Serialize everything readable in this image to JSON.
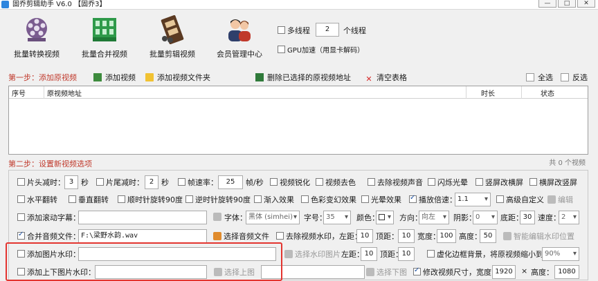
{
  "window": {
    "title": "固乔剪辑助手 V6.0 【固乔3】",
    "minimize": "—",
    "maximize": "□",
    "close": "✕"
  },
  "toolbar": {
    "tools": [
      {
        "label": "批量转换视频",
        "icon": "film-reel-icon"
      },
      {
        "label": "批量合并视频",
        "icon": "building-merge-icon"
      },
      {
        "label": "批量剪辑视频",
        "icon": "film-cut-icon"
      },
      {
        "label": "会员管理中心",
        "icon": "users-icon"
      }
    ],
    "multithread_label": "多线程",
    "thread_count": "2",
    "thread_unit": "个线程",
    "gpu_label": "GPU加速（用显卡解码）"
  },
  "step1": {
    "title": "第一步：添加原视频",
    "add_video": "添加视频",
    "add_folder": "添加视频文件夹",
    "delete_selected": "删除已选择的原视频地址",
    "clear_table": "清空表格",
    "select_all": "全选",
    "invert": "反选"
  },
  "table": {
    "columns": [
      "序号",
      "原视频地址",
      "时长",
      "状态"
    ],
    "rows": [],
    "count_text": "共 0 个视频"
  },
  "step2": {
    "title": "第二步：设置新视频选项",
    "row1": {
      "head_cut": "片头减时：",
      "head_val": "3",
      "sec1": "秒",
      "tail_cut": "片尾减时：",
      "tail_val": "2",
      "sec2": "秒",
      "framerate": "帧速率：",
      "framerate_val": "25",
      "fps": "帧/秒",
      "sharpen": "视频锐化",
      "decolor": "视频去色",
      "remove_audio": "去除视频声音",
      "flash": "闪烁光晕",
      "portrait_to_landscape": "竖屏改横屏",
      "landscape_to_portrait": "横屏改竖屏"
    },
    "row2": {
      "hflip": "水平翻转",
      "vflip": "垂直翻转",
      "cw90": "顺时针旋转90度",
      "ccw90": "逆时针旋转90度",
      "fade_in": "渐入效果",
      "color_change": "色彩变幻效果",
      "light": "光晕效果",
      "speed": "播放倍速：",
      "speed_val": "1.1",
      "advanced": "高级自定义",
      "edit": "编辑"
    },
    "row3": {
      "scroll_subtitle": "添加滚动字幕：",
      "font_label": "字体：",
      "font_val": "黑体 (simhei)",
      "size_label": "字号：",
      "size_val": "35",
      "color_label": "颜色：",
      "dir_label": "方向：",
      "dir_val": "向左",
      "shadow_label": "阴影：",
      "shadow_val": "0",
      "bottom_label": "底距：",
      "bottom_val": "30",
      "speed_label": "速度：",
      "speed_val": "2"
    },
    "row4": {
      "merge_audio": "合并音频文件：",
      "audio_path": "F:\\梁野水韵.wav",
      "select_audio": "选择音频文件",
      "remove_watermark": "去除视频水印，左距：",
      "left_val": "10",
      "top_label": "顶距：",
      "top_val": "10",
      "width_label": "宽度：",
      "width_val": "100",
      "height_label": "高度：",
      "height_val": "50",
      "smart": "智能编辑水印位置"
    },
    "row5": {
      "add_image_wm": "添加图片水印：",
      "select_wm": "选择水印图片",
      "left_label": "左距：",
      "left_val": "10",
      "top_label": "顶距：",
      "top_val": "10",
      "blur_border": "虚化边框背景，将原视频缩小到：",
      "scale_val": "90%"
    },
    "row6": {
      "add_topbottom": "添加上下图片水印：",
      "select_top": "选择上图",
      "select_bottom": "选择下图",
      "resize": "修改视频尺寸，宽度：",
      "w_val": "1920",
      "x": "×",
      "h_label": "高度：",
      "h_val": "1080"
    }
  }
}
